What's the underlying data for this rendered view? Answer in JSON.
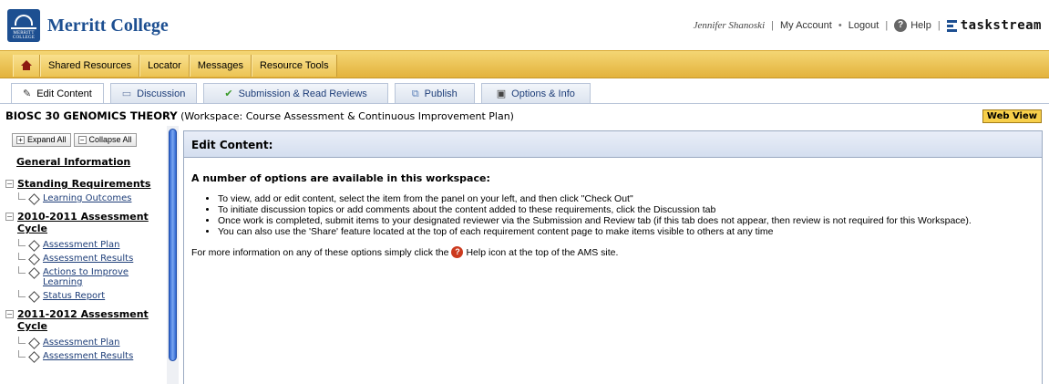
{
  "header": {
    "logo_text": "MERRITT COLLEGE",
    "brand": "Merritt College",
    "user_name": "Jennifer Shanoski",
    "my_account": "My Account",
    "dot": "•",
    "logout": "Logout",
    "help": "Help",
    "taskstream": "taskstream",
    "sep": "|"
  },
  "nav": {
    "items": [
      "Shared Resources",
      "Locator",
      "Messages",
      "Resource Tools"
    ]
  },
  "tabs": [
    {
      "label": "Edit Content",
      "icon": "✎"
    },
    {
      "label": "Discussion",
      "icon": "▭"
    },
    {
      "label": "Submission & Read Reviews",
      "icon": "✔"
    },
    {
      "label": "Publish",
      "icon": "⧉"
    },
    {
      "label": "Options & Info",
      "icon": "▣"
    }
  ],
  "title": {
    "course": "BIOSC 30 GENOMICS THEORY",
    "workspace": " (Workspace: Course Assessment & Continuous Improvement Plan)",
    "web_view": "Web View"
  },
  "left_panel": {
    "expand_all": "Expand All",
    "collapse_all": "Collapse All",
    "general_information": "General Information",
    "groups": [
      {
        "label": "Standing Requirements",
        "items": [
          "Learning Outcomes"
        ]
      },
      {
        "label": "2010-2011 Assessment Cycle",
        "items": [
          "Assessment Plan",
          "Assessment Results",
          "Actions to Improve Learning",
          "Status Report"
        ]
      },
      {
        "label": "2011-2012 Assessment Cycle",
        "items": [
          "Assessment Plan",
          "Assessment Results"
        ]
      }
    ]
  },
  "content": {
    "heading": "Edit Content:",
    "intro": "A number of options are available in this workspace:",
    "bullets": [
      "To view, add or edit content, select the item from the panel on your left, and then click \"Check Out\"",
      "To initiate discussion topics or add comments about the content added to these requirements, click the Discussion tab",
      "Once work is completed, submit items to your designated reviewer via the Submission and Review tab (if this tab does not appear, then review is not required for this Workspace).",
      "You can also use the 'Share' feature located at the top of each requirement content page to make items visible to others at any time"
    ],
    "more_before": "For more information on any of these options simply click the",
    "more_after": "Help icon at the top of the AMS site."
  }
}
